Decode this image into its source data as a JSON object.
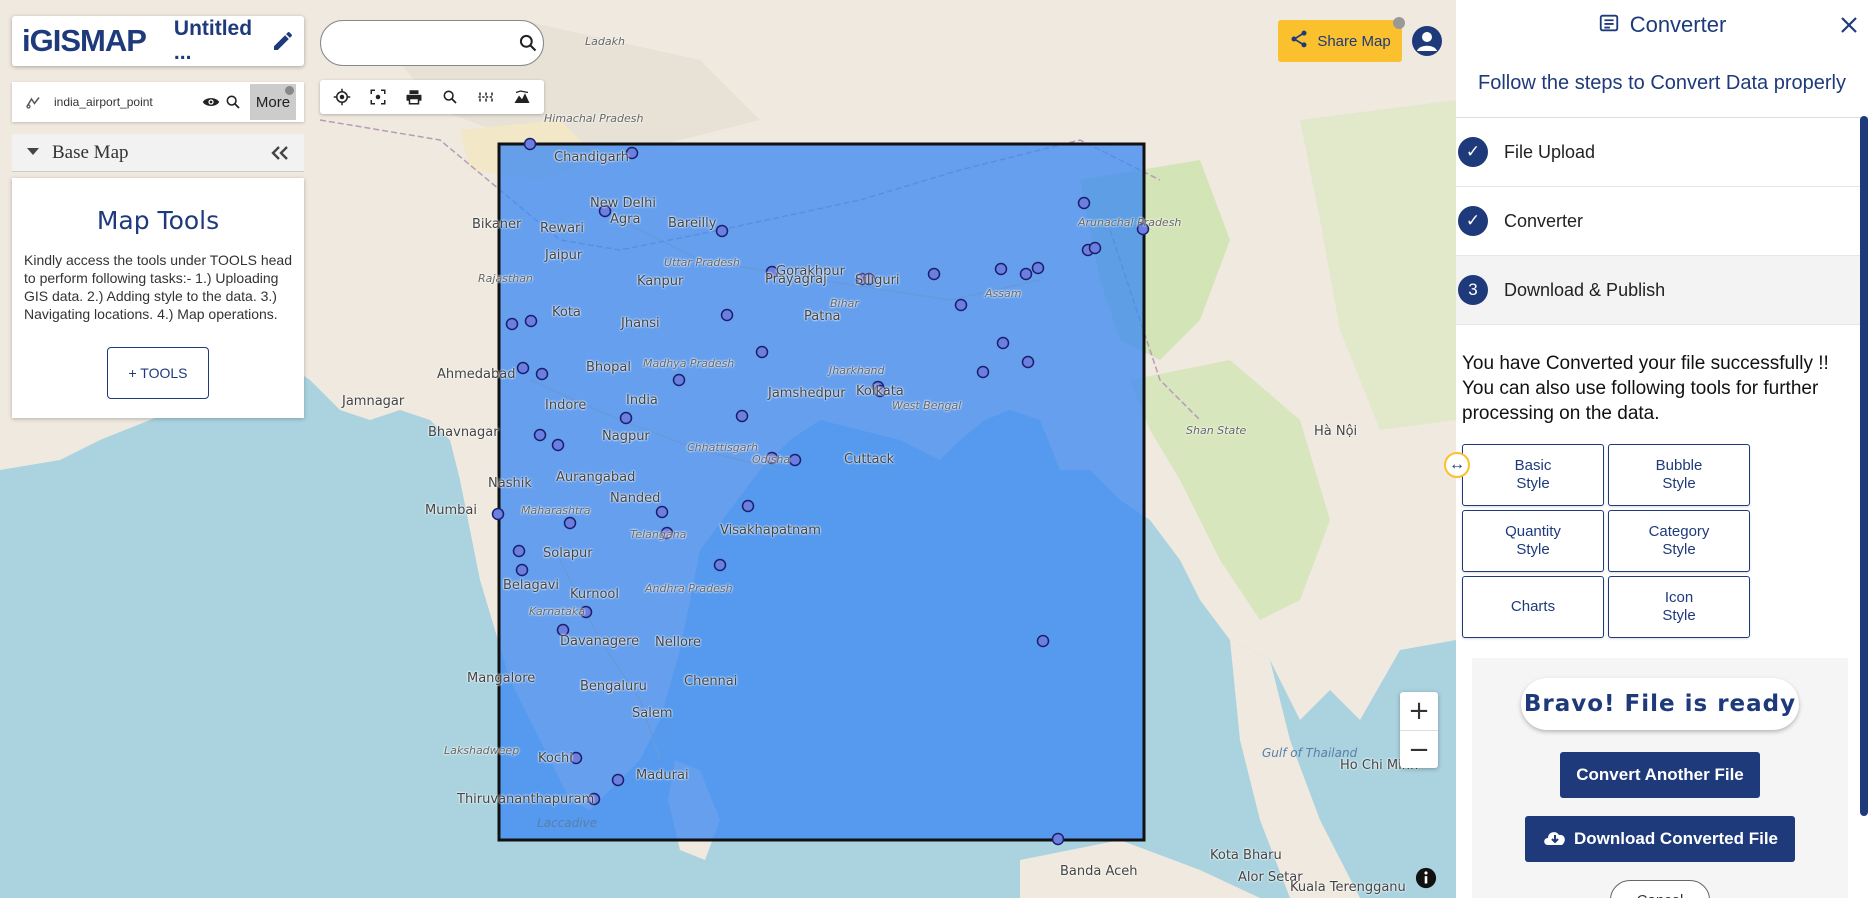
{
  "app": {
    "logo_text": "iGISMAP",
    "map_title": "Untitled ...",
    "search_placeholder": ""
  },
  "layer": {
    "name": "india_airport_point",
    "more_label": "More"
  },
  "basemap": {
    "label": "Base Map"
  },
  "tools_panel": {
    "title": "Map Tools",
    "description": "Kindly access the tools under TOOLS head to perform following tasks:- 1.) Uploading GIS data. 2.) Adding style to the data. 3.) Navigating locations. 4.) Map operations.",
    "button_label": "+ TOOLS"
  },
  "share": {
    "label": "Share Map"
  },
  "zoom": {
    "in_label": "+",
    "out_label": "−"
  },
  "converter": {
    "title": "Converter",
    "subtitle": "Follow the steps to Convert Data properly",
    "steps": [
      {
        "badge": "✓",
        "label": "File Upload"
      },
      {
        "badge": "✓",
        "label": "Converter"
      },
      {
        "badge": "3",
        "label": "Download & Publish"
      }
    ],
    "success_line1": "You have Converted your file successfully !!",
    "success_line2": "You can also use following tools for further processing on the data.",
    "style_buttons": [
      {
        "line1": "Basic",
        "line2": "Style"
      },
      {
        "line1": "Bubble",
        "line2": "Style"
      },
      {
        "line1": "Quantity",
        "line2": "Style"
      },
      {
        "line1": "Category",
        "line2": "Style"
      },
      {
        "line1": "Charts",
        "line2": ""
      },
      {
        "line1": "Icon",
        "line2": "Style"
      }
    ],
    "ready_label": "Bravo! File is ready",
    "convert_another_label": "Convert Another File",
    "download_label": "Download Converted File",
    "bottom_pill_label": "Cancel"
  },
  "map_labels": [
    {
      "text": "Ladakh",
      "cls": "small"
    },
    {
      "text": "Chandigarh",
      "cls": ""
    },
    {
      "text": "New Delhi",
      "cls": ""
    },
    {
      "text": "Bikaner",
      "cls": ""
    },
    {
      "text": "Rewari",
      "cls": ""
    },
    {
      "text": "Jaipur",
      "cls": ""
    },
    {
      "text": "Agra",
      "cls": ""
    },
    {
      "text": "Bareilly",
      "cls": ""
    },
    {
      "text": "Kanpur",
      "cls": ""
    },
    {
      "text": "Uttar Pradesh",
      "cls": "small"
    },
    {
      "text": "Gorakhpur",
      "cls": ""
    },
    {
      "text": "Prayagraj",
      "cls": ""
    },
    {
      "text": "Siliguri",
      "cls": ""
    },
    {
      "text": "Patna",
      "cls": ""
    },
    {
      "text": "Kota",
      "cls": ""
    },
    {
      "text": "Jhansi",
      "cls": ""
    },
    {
      "text": "Bihar",
      "cls": "small"
    },
    {
      "text": "Assam",
      "cls": "small"
    },
    {
      "text": "Ahmedabad",
      "cls": ""
    },
    {
      "text": "Bhopal",
      "cls": ""
    },
    {
      "text": "Madhya Pradesh",
      "cls": "small"
    },
    {
      "text": "Jharkhand",
      "cls": "small"
    },
    {
      "text": "West Bengal",
      "cls": "small"
    },
    {
      "text": "India",
      "cls": ""
    },
    {
      "text": "Indore",
      "cls": ""
    },
    {
      "text": "Jamshedpur",
      "cls": ""
    },
    {
      "text": "Kolkata",
      "cls": ""
    },
    {
      "text": "Jamnagar",
      "cls": ""
    },
    {
      "text": "Bhavnagar",
      "cls": ""
    },
    {
      "text": "Nagpur",
      "cls": ""
    },
    {
      "text": "Chhattisgarh",
      "cls": "small"
    },
    {
      "text": "Odisha",
      "cls": "small"
    },
    {
      "text": "Cuttack",
      "cls": ""
    },
    {
      "text": "Aurangabad",
      "cls": ""
    },
    {
      "text": "Nashik",
      "cls": ""
    },
    {
      "text": "Mumbai",
      "cls": ""
    },
    {
      "text": "Maharashtra",
      "cls": "small"
    },
    {
      "text": "Nanded",
      "cls": ""
    },
    {
      "text": "Telangana",
      "cls": "small"
    },
    {
      "text": "Visakhapatnam",
      "cls": ""
    },
    {
      "text": "Solapur",
      "cls": ""
    },
    {
      "text": "Belagavi",
      "cls": ""
    },
    {
      "text": "Kurnool",
      "cls": ""
    },
    {
      "text": "Andhra Pradesh",
      "cls": "small"
    },
    {
      "text": "Karnataka",
      "cls": "small"
    },
    {
      "text": "Davanagere",
      "cls": ""
    },
    {
      "text": "Nellore",
      "cls": ""
    },
    {
      "text": "Mangalore",
      "cls": ""
    },
    {
      "text": "Bengaluru",
      "cls": ""
    },
    {
      "text": "Chennai",
      "cls": ""
    },
    {
      "text": "Salem",
      "cls": ""
    },
    {
      "text": "Lakshadweep",
      "cls": "small"
    },
    {
      "text": "Kochi",
      "cls": ""
    },
    {
      "text": "Madurai",
      "cls": ""
    },
    {
      "text": "Thiruvananthapuram",
      "cls": ""
    },
    {
      "text": "Laccadive",
      "cls": "water"
    },
    {
      "text": "Banda Aceh",
      "cls": ""
    },
    {
      "text": "Kota Bharu",
      "cls": ""
    },
    {
      "text": "Alor Setar",
      "cls": ""
    },
    {
      "text": "Kuala Terengganu",
      "cls": ""
    },
    {
      "text": "Gulf of Thailand",
      "cls": "water"
    },
    {
      "text": "Ho Chi Minh",
      "cls": ""
    },
    {
      "text": "Hà Nội",
      "cls": ""
    },
    {
      "text": "Shan State",
      "cls": "small"
    },
    {
      "text": "Arunachal Pradesh",
      "cls": "small"
    },
    {
      "text": "Rajasthan",
      "cls": "small"
    },
    {
      "text": "Himachal Pradesh",
      "cls": "small"
    }
  ]
}
